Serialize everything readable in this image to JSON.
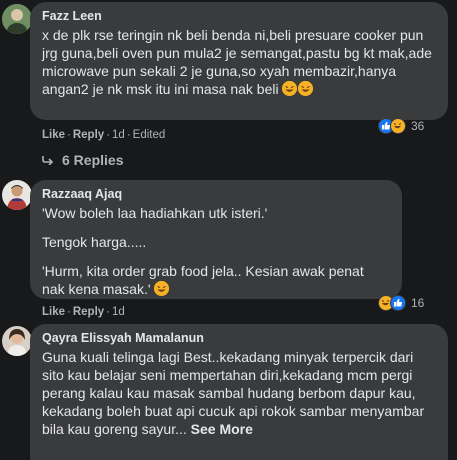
{
  "comments": [
    {
      "author": "Fazz Leen",
      "text": "x de plk rse teringin nk beli benda ni,beli presuare cooker pun jrg guna,beli oven pun mula2 je semangat,pastu bg kt mak,ade microwave pun sekali 2 je guna,so xyah membazir,hanya angan2 je nk msk itu ini masa nak beli",
      "like_label": "Like",
      "reply_label": "Reply",
      "time": "1d",
      "edited": "Edited",
      "reaction_count": "36",
      "replies_label": "6 Replies"
    },
    {
      "author": "Razzaaq Ajaq",
      "para1": "'Wow boleh laa hadiahkan utk isteri.'",
      "para2": "Tengok harga.....",
      "para3": "'Hurm, kita order grab food jela.. Kesian awak penat nak kena masak.'",
      "like_label": "Like",
      "reply_label": "Reply",
      "time": "1d",
      "reaction_count": "16"
    },
    {
      "author": "Qayra Elissyah Mamalanun",
      "text": "Guna kuali telinga lagi Best..kekadang minyak terpercik dari sito kau belajar seni mempertahan diri,kekadang mcm pergi perang kalau kau masak sambal hudang berbom dapur kau, kekadang boleh buat api cucuk api rokok sambar menyambar bila kau goreng sayur...",
      "see_more": "See More"
    }
  ],
  "colors": {
    "background": "#18191a",
    "bubble": "#3a3b3c",
    "text": "#e4e6eb",
    "secondary": "#b0b3b8",
    "like_blue": "#1877f2",
    "haha_yellow": "#f7b125"
  },
  "icons": [
    "avatar",
    "like-reaction-icon",
    "haha-reaction-icon",
    "reply-arrow-icon",
    "laughing-emoji-icon"
  ]
}
